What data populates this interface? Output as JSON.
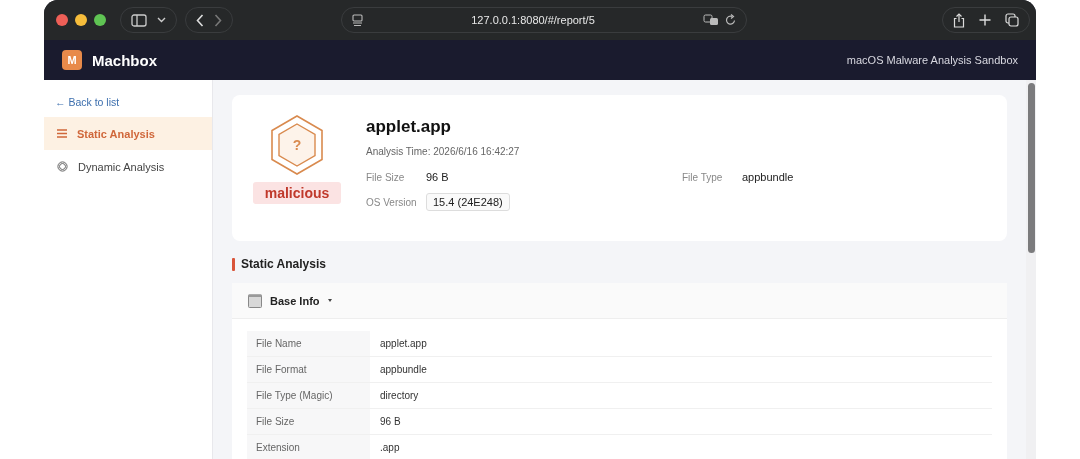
{
  "browser": {
    "url": "127.0.0.1:8080/#/report/5"
  },
  "app": {
    "brand": "Machbox",
    "logo_letter": "M",
    "tagline": "macOS Malware Analysis Sandbox"
  },
  "sidebar": {
    "back_link": "← Back to list",
    "items": [
      {
        "label": "Static Analysis",
        "kind": "list",
        "selected": true
      },
      {
        "label": "Dynamic Analysis",
        "kind": "ring",
        "selected": false
      }
    ]
  },
  "report": {
    "icon_glyph": "?",
    "title": "applet.app",
    "verdict": "malicious",
    "analysis_time": "Analysis Time: 2026/6/16 16:42:27",
    "fields": [
      {
        "label": "File Size",
        "value": "96 B",
        "kind": "plain"
      },
      {
        "label": "File Type",
        "value": "appbundle",
        "kind": "plain"
      },
      {
        "label": "OS Version",
        "value": "15.4 (24E248)",
        "kind": "tag"
      }
    ]
  },
  "section_title": "Static Analysis",
  "panel": {
    "title": "Base Info",
    "expanded": true,
    "rows": [
      {
        "label": "File Name",
        "value": "applet.app"
      },
      {
        "label": "File Format",
        "value": "appbundle"
      },
      {
        "label": "File Type (Magic)",
        "value": "directory"
      },
      {
        "label": "File Size",
        "value": "96 B"
      },
      {
        "label": "Extension",
        "value": ".app"
      }
    ]
  }
}
